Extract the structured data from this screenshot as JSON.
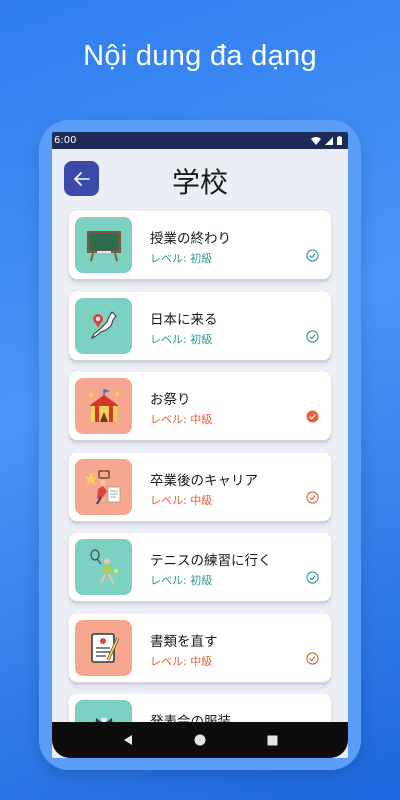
{
  "headline": "Nội dung đa dạng",
  "status": {
    "time": "6:00"
  },
  "appbar": {
    "title": "学校"
  },
  "colors": {
    "accent": "#3b4aa8",
    "teal": "#2a9d8f",
    "orange": "#e8603c"
  },
  "lessons": [
    {
      "title": "授業の終わり",
      "level": "レベル: 初級",
      "icon": "blackboard-icon",
      "status": "outline-teal"
    },
    {
      "title": "日本に来る",
      "level": "レベル: 初級",
      "icon": "japan-map-icon",
      "status": "outline-teal"
    },
    {
      "title": "お祭り",
      "level": "レベル: 中級",
      "icon": "festival-tent-icon",
      "status": "filled-orange"
    },
    {
      "title": "卒業後のキャリア",
      "level": "レベル: 中級",
      "icon": "career-icon",
      "status": "outline-orange"
    },
    {
      "title": "テニスの練習に行く",
      "level": "レベル: 初級",
      "icon": "tennis-player-icon",
      "status": "outline-teal"
    },
    {
      "title": "書類を直す",
      "level": "レベル: 中級",
      "icon": "document-icon",
      "status": "outline-orange"
    },
    {
      "title": "発表会の服装",
      "level": "",
      "icon": "suit-icon",
      "status": ""
    }
  ]
}
